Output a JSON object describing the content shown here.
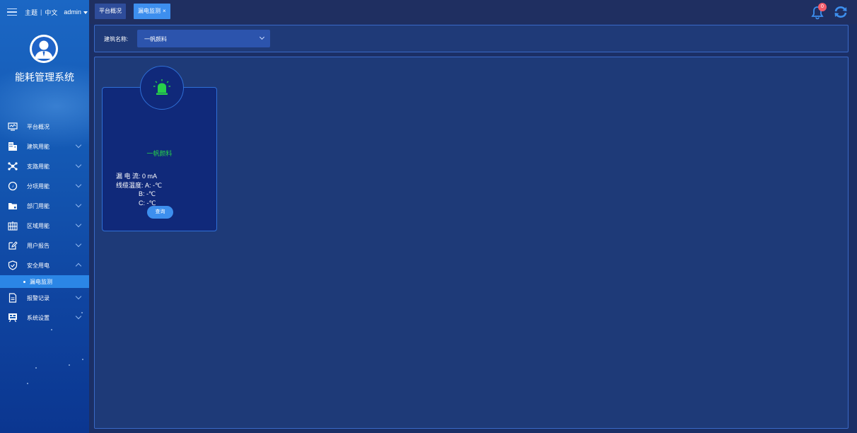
{
  "topbar": {
    "theme_label": "主题",
    "separator": "|",
    "language_label": "中文",
    "user_label": "admin"
  },
  "system_title": "能耗管理系统",
  "sidebar": {
    "items": [
      {
        "label": "平台概况",
        "icon": "monitor-icon",
        "expandable": false
      },
      {
        "label": "建筑用能",
        "icon": "building-icon",
        "expandable": true
      },
      {
        "label": "支路用能",
        "icon": "network-icon",
        "expandable": true
      },
      {
        "label": "分项用能",
        "icon": "gauge-icon",
        "expandable": true
      },
      {
        "label": "部门用能",
        "icon": "folder-icon",
        "expandable": true
      },
      {
        "label": "区域用能",
        "icon": "grid-icon",
        "expandable": true
      },
      {
        "label": "用户报告",
        "icon": "edit-icon",
        "expandable": true
      },
      {
        "label": "安全用电",
        "icon": "shield-icon",
        "expandable": true,
        "expanded": true
      },
      {
        "label": "报警记录",
        "icon": "document-icon",
        "expandable": true
      },
      {
        "label": "系统设置",
        "icon": "settings-board-icon",
        "expandable": true
      }
    ],
    "sub_item": {
      "label": "漏电监测",
      "active": true
    }
  },
  "tabs": [
    {
      "label": "平台概况",
      "active": false
    },
    {
      "label": "漏电监测",
      "active": true,
      "close": "×"
    }
  ],
  "notifications": {
    "count": "0"
  },
  "filter": {
    "label": "建筑名称:",
    "selected": "一帆颜料"
  },
  "card": {
    "name": "一帆颜料",
    "leak_current_label": "漏 电 流:",
    "leak_current_value": "0 mA",
    "cable_temp_label": "线缆温度:",
    "phase_a": "A: -℃",
    "phase_b": "B: -℃",
    "phase_c": "C: -℃",
    "query_button": "查询"
  },
  "colors": {
    "sidebar_top": "#1b67c4",
    "header_bg": "#1f2f61",
    "panel_bg": "#1e3a78",
    "accent_blue": "#3d8fee",
    "alarm_green": "#27d14a",
    "badge_red": "#f05b6a"
  }
}
